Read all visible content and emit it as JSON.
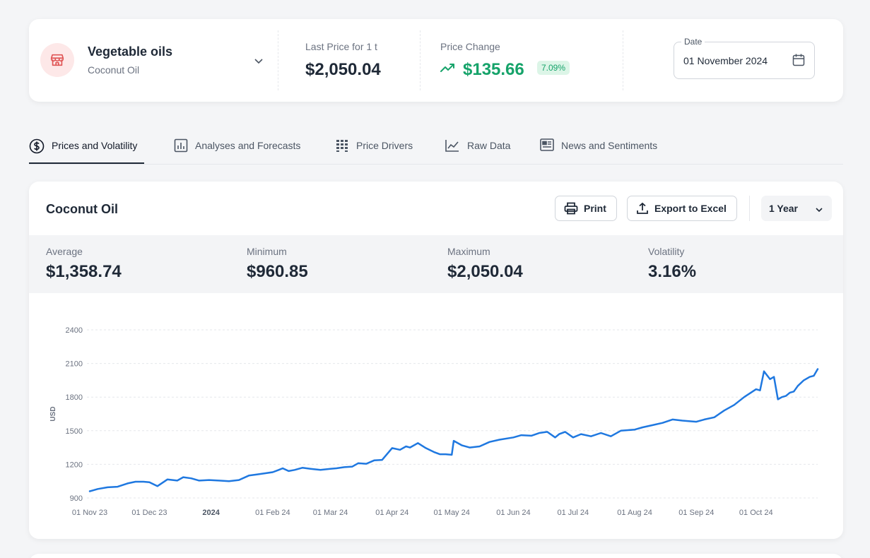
{
  "commodity": {
    "category": "Vegetable oils",
    "product": "Coconut Oil",
    "last_price_label": "Last Price for 1 t",
    "last_price": "$2,050.04",
    "price_change_label": "Price Change",
    "price_change": "$135.66",
    "price_change_pct": "7.09%",
    "date_label": "Date",
    "date_value": "01 November 2024"
  },
  "tabs": [
    {
      "label": "Prices and Volatility",
      "icon": "dollar-circle-icon",
      "active": true
    },
    {
      "label": "Analyses and Forecasts",
      "icon": "bar-chart-icon",
      "active": false
    },
    {
      "label": "Price Drivers",
      "icon": "grid-bars-icon",
      "active": false
    },
    {
      "label": "Raw Data",
      "icon": "trend-chart-icon",
      "active": false
    },
    {
      "label": "News and Sentiments",
      "icon": "newspaper-icon",
      "active": false
    }
  ],
  "panel": {
    "title": "Coconut Oil",
    "print_label": "Print",
    "export_label": "Export to Excel",
    "range_label": "1 Year"
  },
  "stats": {
    "average_label": "Average",
    "average": "$1,358.74",
    "minimum_label": "Minimum",
    "minimum": "$960.85",
    "maximum_label": "Maximum",
    "maximum": "$2,050.04",
    "volatility_label": "Volatility",
    "volatility": "3.16%"
  },
  "colors": {
    "line": "#1f78e0",
    "positive": "#16a36a",
    "positive_bg": "#dcf5e7",
    "icon_bg": "#fde8e8",
    "icon_red": "#e05555"
  },
  "chart_data": {
    "type": "line",
    "ylabel": "USD",
    "ylim": [
      900,
      2400
    ],
    "y_ticks": [
      900,
      1200,
      1500,
      1800,
      2100,
      2400
    ],
    "grid": true,
    "x_ticks": [
      {
        "label": "01 Nov 23",
        "date": "2023-11-01",
        "bold": false
      },
      {
        "label": "01 Dec 23",
        "date": "2023-12-01",
        "bold": false
      },
      {
        "label": "2024",
        "date": "2024-01-01",
        "bold": true
      },
      {
        "label": "01 Feb 24",
        "date": "2024-02-01",
        "bold": false
      },
      {
        "label": "01 Mar 24",
        "date": "2024-03-01",
        "bold": false
      },
      {
        "label": "01 Apr 24",
        "date": "2024-04-01",
        "bold": false
      },
      {
        "label": "01 May 24",
        "date": "2024-05-01",
        "bold": false
      },
      {
        "label": "01 Jun 24",
        "date": "2024-06-01",
        "bold": false
      },
      {
        "label": "01 Jul 24",
        "date": "2024-07-01",
        "bold": false
      },
      {
        "label": "01 Aug 24",
        "date": "2024-08-01",
        "bold": false
      },
      {
        "label": "01 Sep 24",
        "date": "2024-09-01",
        "bold": false
      },
      {
        "label": "01 Oct 24",
        "date": "2024-10-01",
        "bold": false
      }
    ],
    "series": [
      {
        "x": [
          "2023-11-01",
          "2023-11-05",
          "2023-11-10",
          "2023-11-15",
          "2023-11-20",
          "2023-11-24",
          "2023-11-28",
          "2023-12-01",
          "2023-12-05",
          "2023-12-10",
          "2023-12-15",
          "2023-12-18",
          "2023-12-22",
          "2023-12-26",
          "2023-12-31",
          "2024-01-05",
          "2024-01-10",
          "2024-01-15",
          "2024-01-20",
          "2024-01-24",
          "2024-01-28",
          "2024-02-01",
          "2024-02-04",
          "2024-02-06",
          "2024-02-09",
          "2024-02-12",
          "2024-02-16",
          "2024-02-20",
          "2024-02-25",
          "2024-03-01",
          "2024-03-04",
          "2024-03-08",
          "2024-03-12",
          "2024-03-15",
          "2024-03-19",
          "2024-03-23",
          "2024-03-27",
          "2024-04-01",
          "2024-04-05",
          "2024-04-08",
          "2024-04-10",
          "2024-04-14",
          "2024-04-18",
          "2024-04-22",
          "2024-04-25",
          "2024-04-28",
          "2024-05-01",
          "2024-05-02",
          "2024-05-06",
          "2024-05-10",
          "2024-05-15",
          "2024-05-20",
          "2024-05-25",
          "2024-06-01",
          "2024-06-05",
          "2024-06-10",
          "2024-06-14",
          "2024-06-18",
          "2024-06-22",
          "2024-06-24",
          "2024-06-27",
          "2024-07-01",
          "2024-07-05",
          "2024-07-10",
          "2024-07-15",
          "2024-07-20",
          "2024-07-25",
          "2024-08-01",
          "2024-08-05",
          "2024-08-10",
          "2024-08-15",
          "2024-08-20",
          "2024-08-25",
          "2024-09-01",
          "2024-09-05",
          "2024-09-10",
          "2024-09-15",
          "2024-09-20",
          "2024-09-25",
          "2024-10-01",
          "2024-10-03",
          "2024-10-05",
          "2024-10-08",
          "2024-10-10",
          "2024-10-12",
          "2024-10-14",
          "2024-10-16",
          "2024-10-18",
          "2024-10-20",
          "2024-10-22",
          "2024-10-25",
          "2024-10-28",
          "2024-10-30",
          "2024-11-01"
        ],
        "values": [
          960,
          980,
          995,
          1000,
          1030,
          1045,
          1045,
          1040,
          1005,
          1065,
          1055,
          1085,
          1075,
          1055,
          1060,
          1055,
          1050,
          1060,
          1100,
          1110,
          1120,
          1130,
          1150,
          1165,
          1140,
          1150,
          1170,
          1160,
          1150,
          1160,
          1165,
          1175,
          1180,
          1210,
          1205,
          1235,
          1240,
          1345,
          1330,
          1360,
          1350,
          1390,
          1345,
          1310,
          1290,
          1290,
          1285,
          1410,
          1370,
          1350,
          1360,
          1400,
          1420,
          1440,
          1460,
          1455,
          1480,
          1490,
          1440,
          1470,
          1490,
          1440,
          1470,
          1450,
          1480,
          1450,
          1500,
          1510,
          1530,
          1550,
          1570,
          1600,
          1590,
          1580,
          1600,
          1620,
          1680,
          1730,
          1800,
          1870,
          1860,
          2030,
          1960,
          1980,
          1780,
          1800,
          1810,
          1840,
          1850,
          1900,
          1950,
          1980,
          1990,
          2050
        ]
      }
    ]
  }
}
